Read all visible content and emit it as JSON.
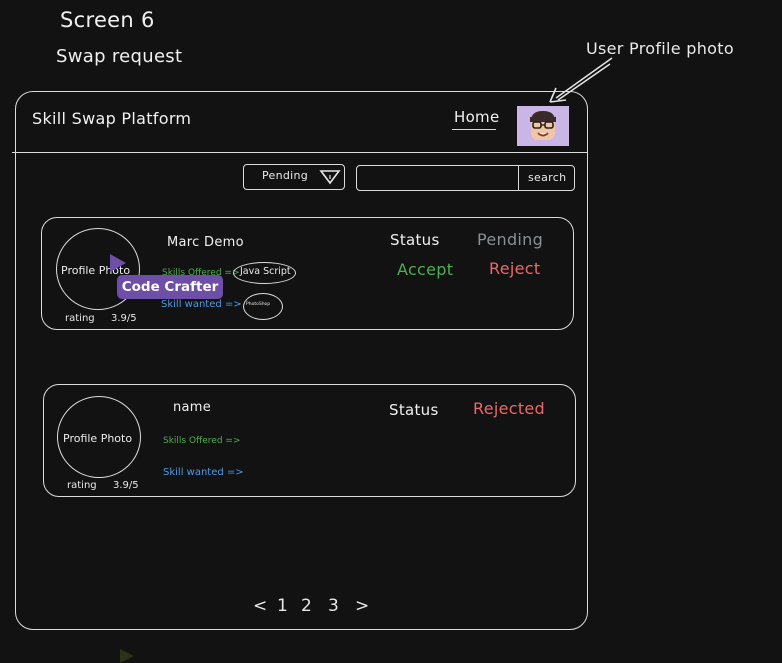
{
  "annotations": {
    "screen_title": "Screen 6",
    "screen_subtitle": "Swap request",
    "profile_photo_note": "User Profile photo"
  },
  "header": {
    "app_title": "Skill Swap Platform",
    "home_link": "Home",
    "avatar_icon": "user-avatar-icon"
  },
  "toolbar": {
    "filter_value": "Pending",
    "filter_icon": "dropdown-triangle-icon",
    "search_placeholder": "",
    "search_button": "search"
  },
  "requests": [
    {
      "photo_label": "Profile Photo",
      "name": "Marc Demo",
      "skills_offered_label": "Skills Offered =>",
      "skill_offered": "Java Script",
      "skill_wanted_label": "Skill wanted =>",
      "skill_wanted": "PhotoShop",
      "rating_label": "rating",
      "rating_value": "3.9/5",
      "status_label": "Status",
      "status_value": "Pending",
      "accept_label": "Accept",
      "reject_label": "Reject",
      "tooltip": "Code Crafter"
    },
    {
      "photo_label": "Profile Photo",
      "name": "name",
      "skills_offered_label": "Skills Offered =>",
      "skill_wanted_label": "Skill wanted =>",
      "rating_label": "rating",
      "rating_value": "3.9/5",
      "status_label": "Status",
      "status_value": "Rejected"
    }
  ],
  "pagination": {
    "prev": "<",
    "pages": [
      "1",
      "2",
      "3"
    ],
    "next": ">"
  },
  "colors": {
    "background": "#121212",
    "accept": "#4caf50",
    "reject": "#e96a6a",
    "pending": "#8a8f96",
    "skill_wanted": "#4a9be8",
    "tooltip": "#6e4fa7",
    "avatar_bg": "#c9b5e6"
  }
}
